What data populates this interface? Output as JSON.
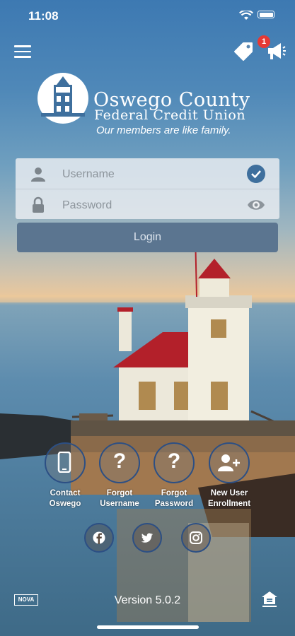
{
  "status_bar": {
    "time": "11:08"
  },
  "header": {
    "notification_count": "1"
  },
  "brand": {
    "line1": "Oswego County",
    "line2": "Federal Credit Union",
    "tagline": "Our members are like family."
  },
  "login_form": {
    "username_placeholder": "Username",
    "password_placeholder": "Password",
    "login_label": "Login"
  },
  "actions": [
    {
      "label_line1": "Contact",
      "label_line2": "Oswego",
      "icon": "phone-icon"
    },
    {
      "label_line1": "Forgot",
      "label_line2": "Username",
      "icon": "question-icon"
    },
    {
      "label_line1": "Forgot",
      "label_line2": "Password",
      "icon": "question-icon"
    },
    {
      "label_line1": "New User",
      "label_line2": "Enrollment",
      "icon": "add-user-icon"
    }
  ],
  "social": [
    "facebook-icon",
    "twitter-icon",
    "instagram-icon"
  ],
  "footer": {
    "nova_badge": "NOVA",
    "version": "Version 5.0.2"
  },
  "colors": {
    "accent_ring": "#2c4f84",
    "login_button": "#5b7590",
    "badge": "#e53935",
    "check": "#3e6f9d"
  }
}
